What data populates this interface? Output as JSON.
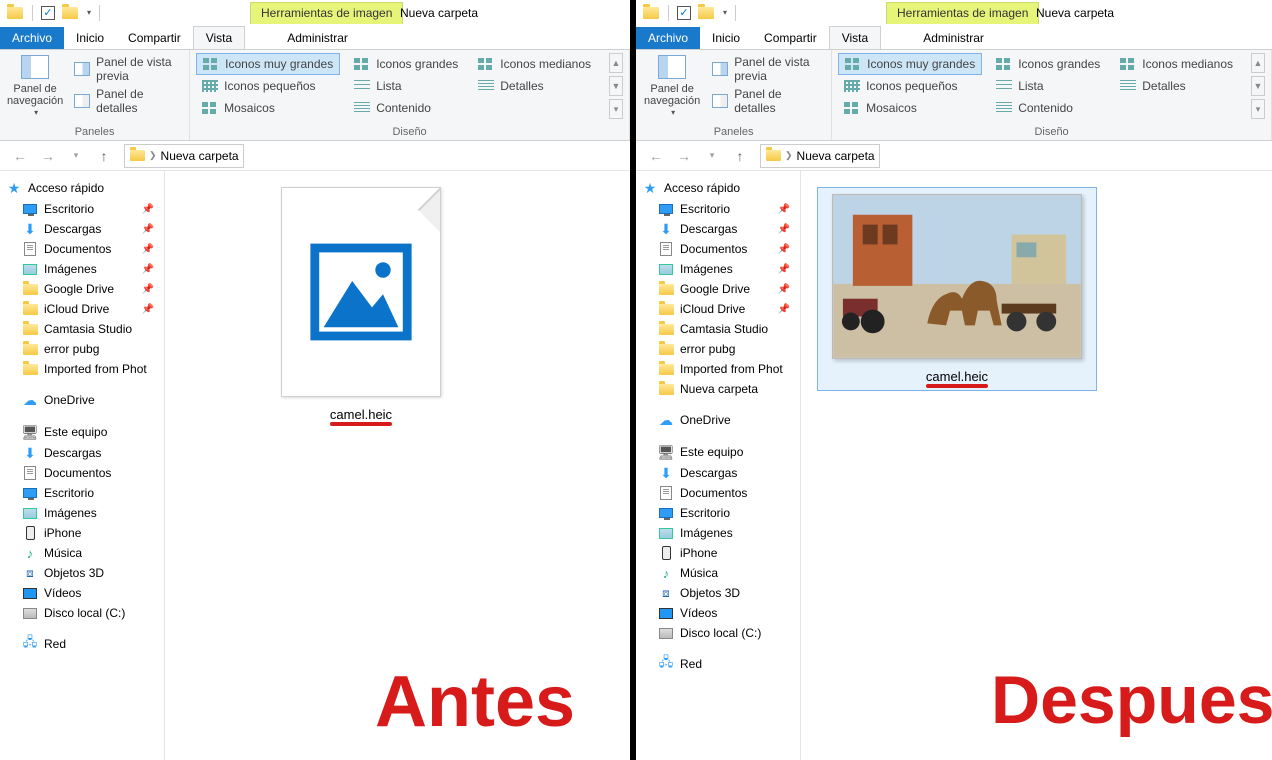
{
  "left": {
    "context_tab": "Herramientas de imagen",
    "win_title": "Nueva carpeta",
    "tabs": {
      "archivo": "Archivo",
      "inicio": "Inicio",
      "compartir": "Compartir",
      "vista": "Vista",
      "admin": "Administrar"
    },
    "ribbon": {
      "panel_nav": "Panel de\nnavegación",
      "preview": "Panel de vista previa",
      "details": "Panel de detalles",
      "group_panels": "Paneles",
      "layouts": {
        "xl": "Iconos muy grandes",
        "lg": "Iconos grandes",
        "md": "Iconos medianos",
        "sm": "Iconos pequeños",
        "list": "Lista",
        "det": "Detalles",
        "tiles": "Mosaicos",
        "content": "Contenido"
      },
      "group_design": "Diseño"
    },
    "crumb": "Nueva carpeta",
    "sidebar": {
      "quick": "Acceso rápido",
      "items_quick": [
        "Escritorio",
        "Descargas",
        "Documentos",
        "Imágenes",
        "Google Drive",
        "iCloud Drive",
        "Camtasia Studio",
        "error pubg",
        "Imported from Phot"
      ],
      "onedrive": "OneDrive",
      "pc": "Este equipo",
      "items_pc": [
        "Descargas",
        "Documentos",
        "Escritorio",
        "Imágenes",
        "iPhone",
        "Música",
        "Objetos 3D",
        "Vídeos",
        "Disco local (C:)"
      ],
      "net": "Red"
    },
    "file": "camel.heic",
    "overlay": "Antes"
  },
  "right": {
    "context_tab": "Herramientas de imagen",
    "win_title": "Nueva carpeta",
    "tabs": {
      "archivo": "Archivo",
      "inicio": "Inicio",
      "compartir": "Compartir",
      "vista": "Vista",
      "admin": "Administrar"
    },
    "ribbon": {
      "panel_nav": "Panel de\nnavegación",
      "preview": "Panel de vista previa",
      "details": "Panel de detalles",
      "group_panels": "Paneles",
      "layouts": {
        "xl": "Iconos muy grandes",
        "lg": "Iconos grandes",
        "md": "Iconos medianos",
        "sm": "Iconos pequeños",
        "list": "Lista",
        "det": "Detalles",
        "tiles": "Mosaicos",
        "content": "Contenido"
      },
      "group_design": "Diseño"
    },
    "crumb": "Nueva carpeta",
    "sidebar": {
      "quick": "Acceso rápido",
      "items_quick": [
        "Escritorio",
        "Descargas",
        "Documentos",
        "Imágenes",
        "Google Drive",
        "iCloud Drive",
        "Camtasia Studio",
        "error pubg",
        "Imported from Phot",
        "Nueva carpeta"
      ],
      "onedrive": "OneDrive",
      "pc": "Este equipo",
      "items_pc": [
        "Descargas",
        "Documentos",
        "Escritorio",
        "Imágenes",
        "iPhone",
        "Música",
        "Objetos 3D",
        "Vídeos",
        "Disco local (C:)"
      ],
      "net": "Red"
    },
    "file": "camel.heic",
    "overlay": "Despues"
  }
}
